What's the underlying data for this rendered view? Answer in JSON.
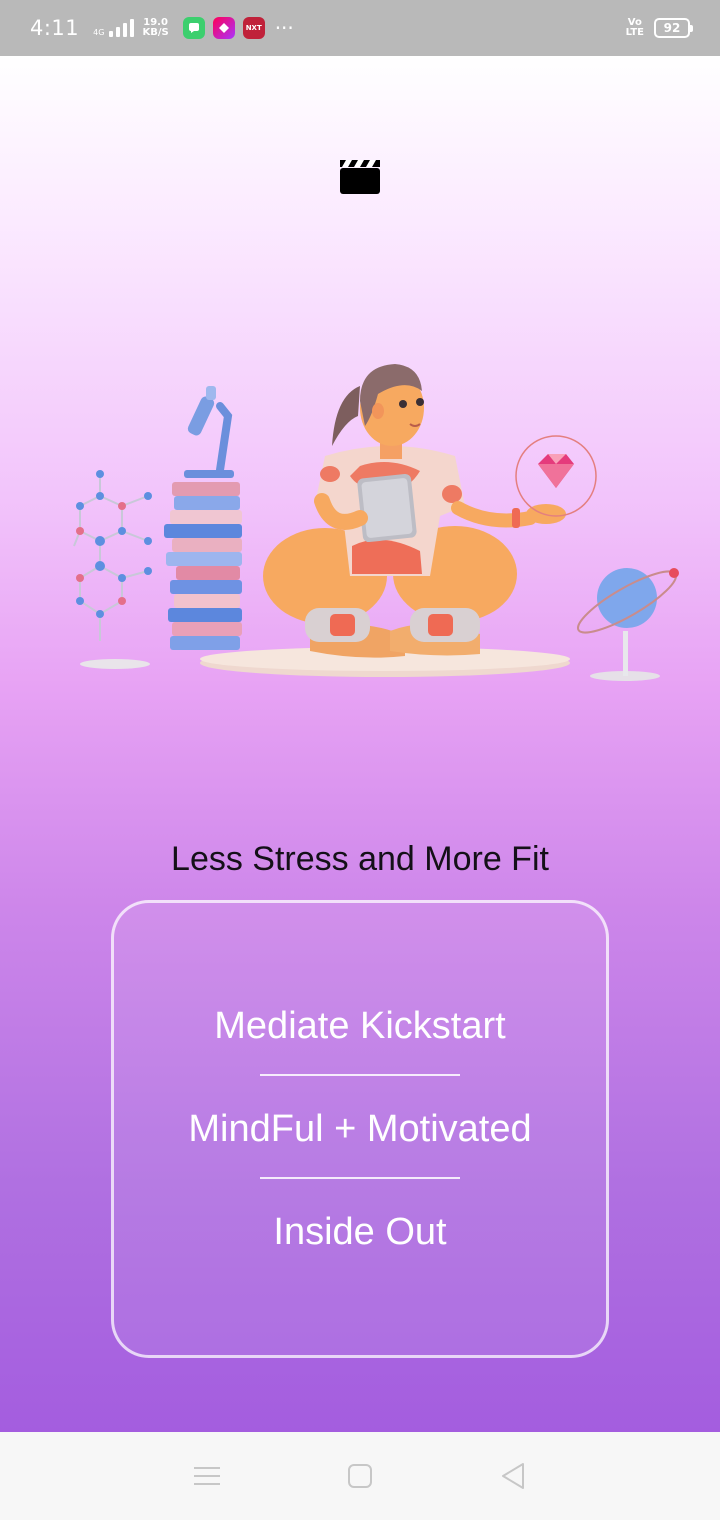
{
  "status_bar": {
    "time": "4:11",
    "network_type": "4G",
    "net_speed_value": "19.0",
    "net_speed_unit": "KB/S",
    "volte_top": "Vo",
    "volte_bottom": "LTE",
    "battery": "92",
    "app_icons": [
      "message-app-icon",
      "shortcut-app-icon",
      "news-app-icon"
    ],
    "news_badge_text": "NXT"
  },
  "header": {
    "icon": "clapperboard-icon"
  },
  "hero": {
    "illustration": "meditation-girl-illustration"
  },
  "tagline": "Less Stress and More Fit",
  "card": {
    "lines": [
      "Mediate Kickstart",
      "MindFul + Motivated",
      "Inside Out"
    ]
  },
  "nav_bar": {
    "buttons": [
      "menu-icon",
      "home-icon",
      "back-icon"
    ]
  },
  "colors": {
    "gradient_top": "#ffffff",
    "gradient_mid": "#e7a2f4",
    "gradient_bottom": "#a45ddf",
    "tagline_text": "#141018",
    "card_text": "#ffffff",
    "status_bar": "#b9b9b9"
  }
}
